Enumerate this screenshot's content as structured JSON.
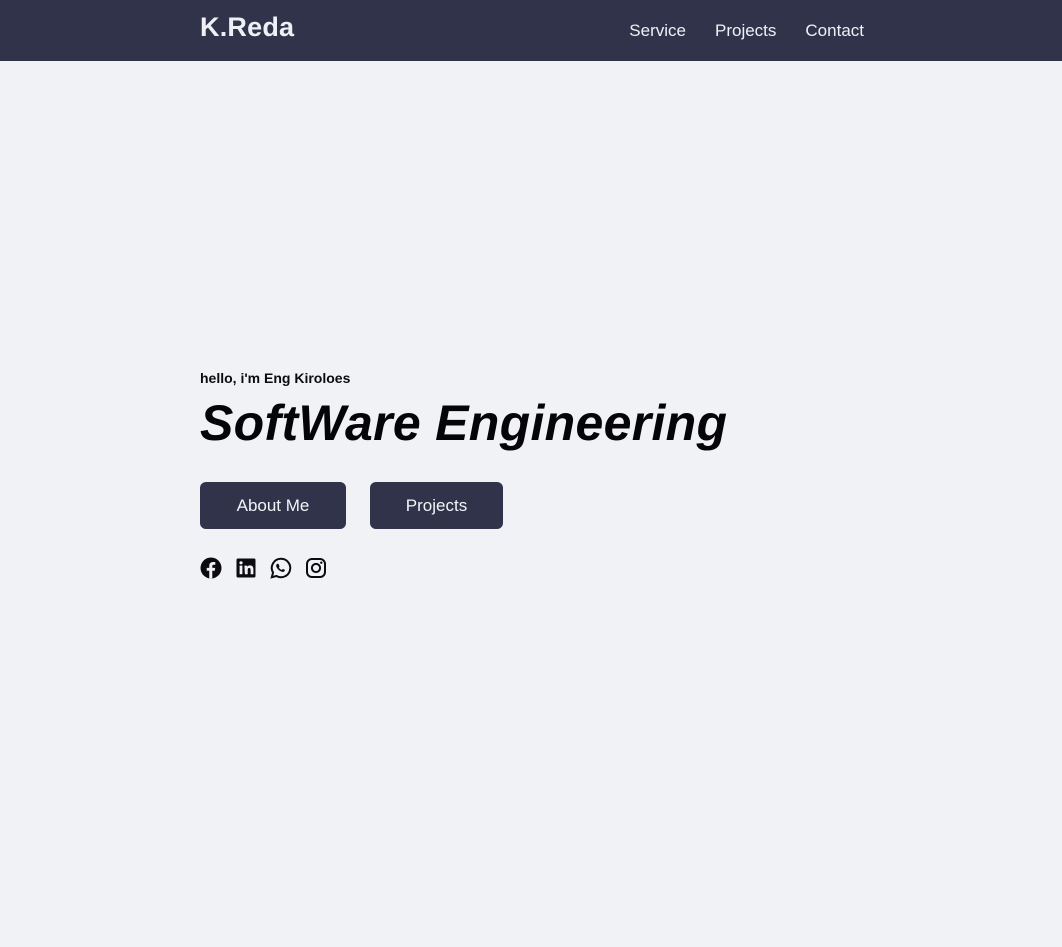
{
  "navbar": {
    "brand": "K.Reda",
    "links": [
      {
        "label": "Service"
      },
      {
        "label": "Projects"
      },
      {
        "label": "Contact"
      }
    ]
  },
  "hero": {
    "greeting": "hello, i'm Eng Kiroloes",
    "headline": "SoftWare Engineering",
    "buttons": {
      "about_label": "About Me",
      "projects_label": "Projects"
    },
    "socials": [
      {
        "icon": "facebook-icon"
      },
      {
        "icon": "linkedin-icon"
      },
      {
        "icon": "whatsapp-icon"
      },
      {
        "icon": "instagram-icon"
      }
    ]
  },
  "colors": {
    "navbar_bg": "#31334a",
    "page_bg": "#f1f2f6",
    "button_bg": "#31334a",
    "nav_text": "#eef0f6"
  }
}
